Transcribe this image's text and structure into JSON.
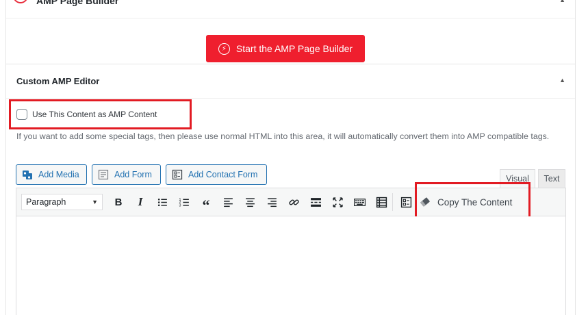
{
  "builder_panel": {
    "title": "AMP Page Builder",
    "button_label": "Start the AMP Page Builder"
  },
  "editor_panel": {
    "title": "Custom AMP Editor",
    "checkbox_label": "Use This Content as AMP Content",
    "help_text": "If you want to add some special tags, then please use normal HTML into this area, it will automatically convert them into AMP compatible tags."
  },
  "media_buttons": {
    "add_media": "Add Media",
    "add_form": "Add Form",
    "add_contact_form": "Add Contact Form"
  },
  "tabs": {
    "visual": "Visual",
    "text": "Text"
  },
  "toolbar": {
    "format_select": "Paragraph",
    "copy_content": "Copy The Content",
    "buttons": [
      "bold",
      "italic",
      "bulleted-list",
      "numbered-list",
      "blockquote",
      "align-left",
      "align-center",
      "align-right",
      "insert-link",
      "read-more",
      "fullscreen",
      "keyboard",
      "table",
      "form"
    ]
  },
  "colors": {
    "accent_red": "#ef1f2e",
    "highlight_red": "#e21b23",
    "link_blue": "#2271b1"
  }
}
